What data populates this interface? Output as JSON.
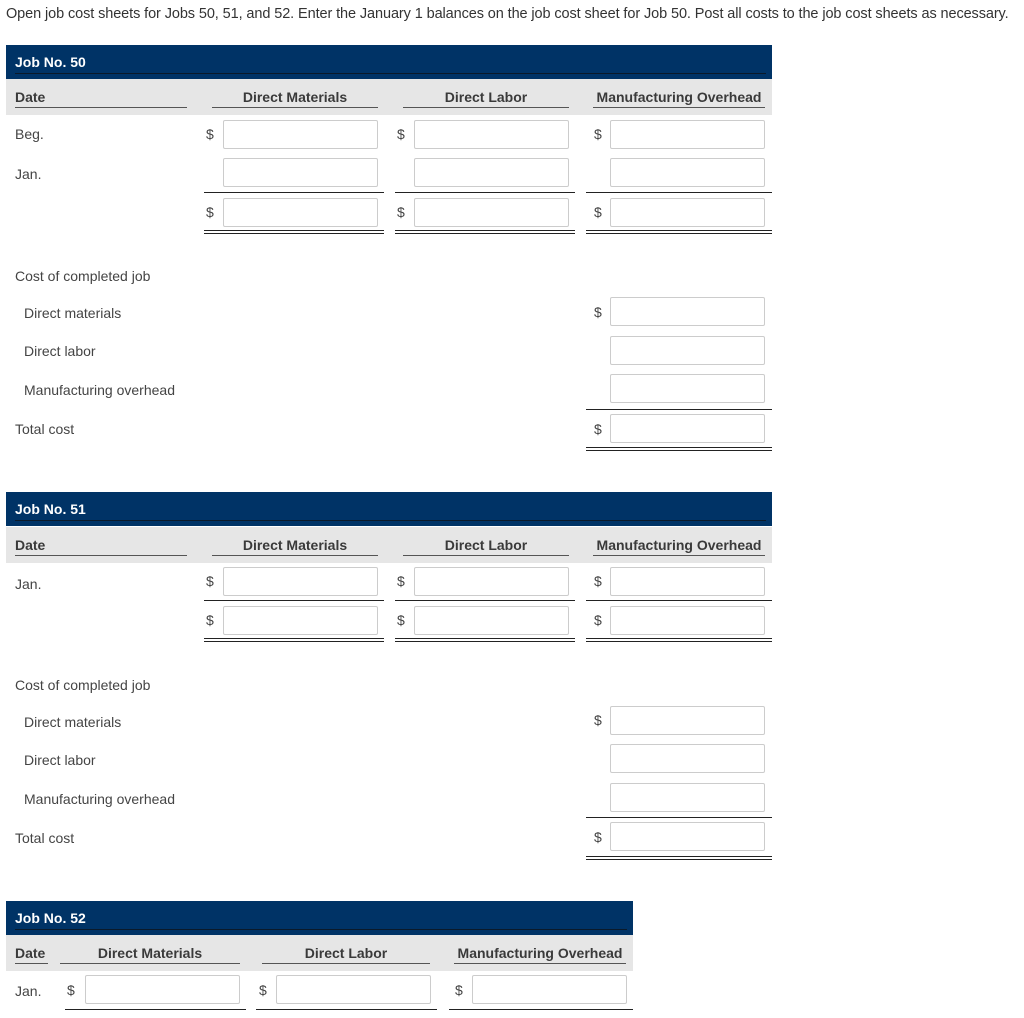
{
  "instruction": "Open job cost sheets for Jobs 50, 51, and 52. Enter the January 1 balances on the job cost sheet for Job 50. Post all costs to the job cost sheets as necessary.",
  "columns": {
    "date": "Date",
    "direct_materials": "Direct Materials",
    "direct_labor": "Direct Labor",
    "manufacturing_overhead": "Manufacturing Overhead"
  },
  "currency_symbol": "$",
  "job50": {
    "title": "Job No. 50",
    "rows": {
      "beg": "Beg.",
      "jan": "Jan."
    },
    "completed": {
      "heading": "Cost of completed job",
      "direct_materials": "Direct materials",
      "direct_labor": "Direct labor",
      "manufacturing_overhead": "Manufacturing overhead",
      "total": "Total cost"
    },
    "values": {
      "beg_dm": "",
      "beg_dl": "",
      "beg_mo": "",
      "jan_dm": "",
      "jan_dl": "",
      "jan_mo": "",
      "tot_dm": "",
      "tot_dl": "",
      "tot_mo": "",
      "c_dm": "",
      "c_dl": "",
      "c_mo": "",
      "c_total": ""
    }
  },
  "job51": {
    "title": "Job No. 51",
    "rows": {
      "jan": "Jan."
    },
    "completed": {
      "heading": "Cost of completed job",
      "direct_materials": "Direct materials",
      "direct_labor": "Direct labor",
      "manufacturing_overhead": "Manufacturing overhead",
      "total": "Total cost"
    }
  },
  "job52": {
    "title": "Job No. 52",
    "rows": {
      "jan": "Jan."
    }
  }
}
